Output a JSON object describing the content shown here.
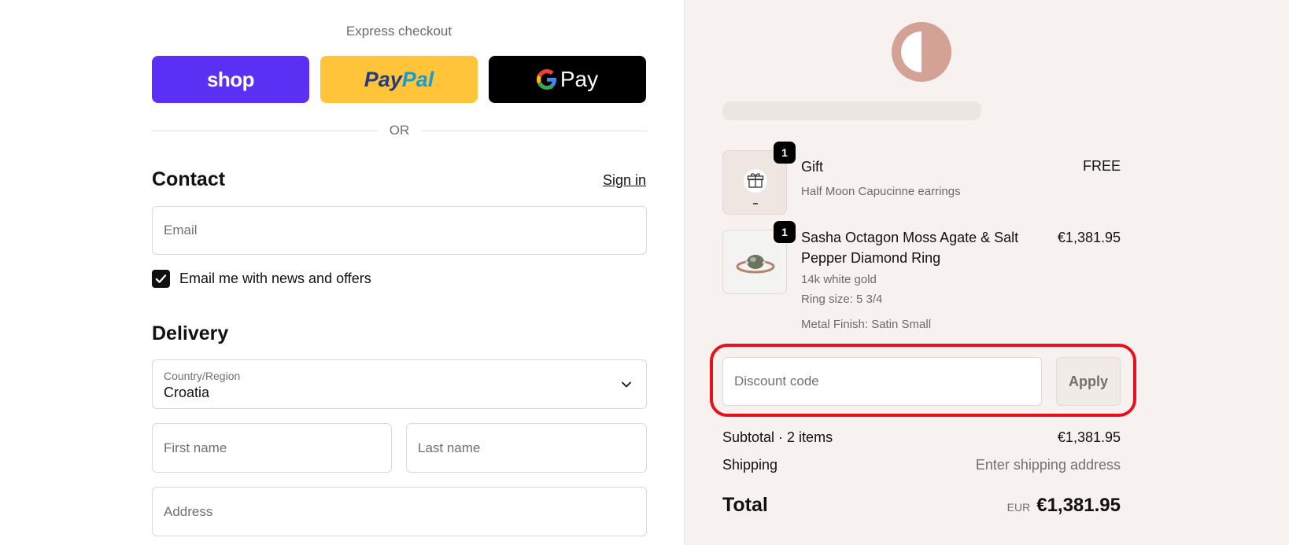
{
  "express": {
    "title": "Express checkout",
    "shop_label": "shop",
    "paypal_part1": "Pay",
    "paypal_part2": "Pal",
    "gpay_label": "Pay",
    "or_label": "OR"
  },
  "contact": {
    "title": "Contact",
    "signin_label": "Sign in",
    "email_placeholder": "Email",
    "newsletter_label": "Email me with news and offers",
    "newsletter_checked": true
  },
  "delivery": {
    "title": "Delivery",
    "country_label": "Country/Region",
    "country_value": "Croatia",
    "first_name_placeholder": "First name",
    "last_name_placeholder": "Last name",
    "address_placeholder": "Address"
  },
  "order": {
    "items": [
      {
        "quantity": "1",
        "name": "Gift",
        "subtitle": "Half Moon Capucinne earrings",
        "price": "FREE"
      },
      {
        "quantity": "1",
        "name_line1": "Sasha Octagon Moss Agate & Salt",
        "name_line2": "Pepper Diamond Ring",
        "variant": "14k white gold",
        "ring_size": "Ring size: 5 3/4",
        "finish": "Metal Finish: Satin Small",
        "price": "€1,381.95"
      }
    ],
    "discount_placeholder": "Discount code",
    "apply_label": "Apply",
    "subtotal_label": "Subtotal · 2 items",
    "subtotal_value": "€1,381.95",
    "shipping_label": "Shipping",
    "shipping_value": "Enter shipping address",
    "total_label": "Total",
    "currency": "EUR",
    "total_value": "€1,381.95"
  },
  "colors": {
    "shop": "#5a31f4",
    "paypal": "#ffc439",
    "gpay": "#000000",
    "logo": "#d4a197",
    "highlight": "#e8101b",
    "sidebar_bg": "#f7f2ef"
  }
}
